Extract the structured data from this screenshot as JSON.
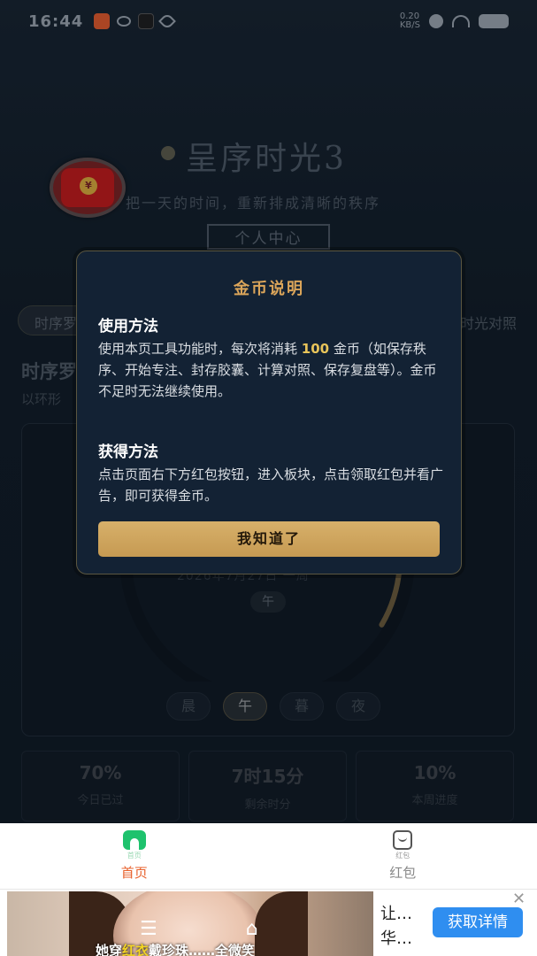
{
  "status_bar": {
    "time": "16:44",
    "net_speed_top": "0.20",
    "net_speed_bottom": "KB/S"
  },
  "app": {
    "title": "呈序时光3",
    "subtitle": "把一天的时间，重新排成清晰的秩序",
    "user_center": "个人中心",
    "tab_left": "时序罗",
    "tab_right": "时光对照",
    "section_title": "时序罗",
    "section_desc": "以环形",
    "clock_date": "2026年7月27日 一周",
    "clock_period": "午",
    "periods": [
      {
        "label": "晨",
        "active": false
      },
      {
        "label": "午",
        "active": true
      },
      {
        "label": "暮",
        "active": false
      },
      {
        "label": "夜",
        "active": false
      }
    ],
    "clock_progress": 0.55,
    "stats": [
      {
        "value": "70%",
        "label": "今日已过"
      },
      {
        "value": "7时15分",
        "label": "剩余时分"
      },
      {
        "value": "10%",
        "label": "本周进度"
      }
    ]
  },
  "modal": {
    "title": "金币说明",
    "usage_heading": "使用方法",
    "usage_text_1": "使用本页工具功能时，每次将消耗 ",
    "usage_coins": "100",
    "usage_text_2": " 金币（如保存秩序、开始专注、封存胶囊、计算对照、保存复盘等）。金币不足时无法继续使用。",
    "earn_heading": "获得方法",
    "earn_text": "点击页面右下方红包按钮，进入板块，点击领取红包并看广告，即可获得金币。",
    "confirm_button": "我知道了"
  },
  "bottom_nav": {
    "items": [
      {
        "icon_caption": "首页",
        "label": "首页",
        "active": true
      },
      {
        "icon_caption": "红包",
        "label": "红包",
        "active": false
      }
    ]
  },
  "ad": {
    "caption_prefix": "她穿",
    "caption_highlight": "红衣",
    "caption_suffix": "戴珍珠……全微笑",
    "text_line1": "让…",
    "text_line2": "华…",
    "cta": "获取详情",
    "close": "✕"
  },
  "colors": {
    "accent_gold": "#dba55a",
    "coin_highlight": "#e8c45a",
    "nav_active": "#e8612c",
    "cta_blue": "#2f8ef0",
    "home_icon_green": "#1ec26d"
  }
}
